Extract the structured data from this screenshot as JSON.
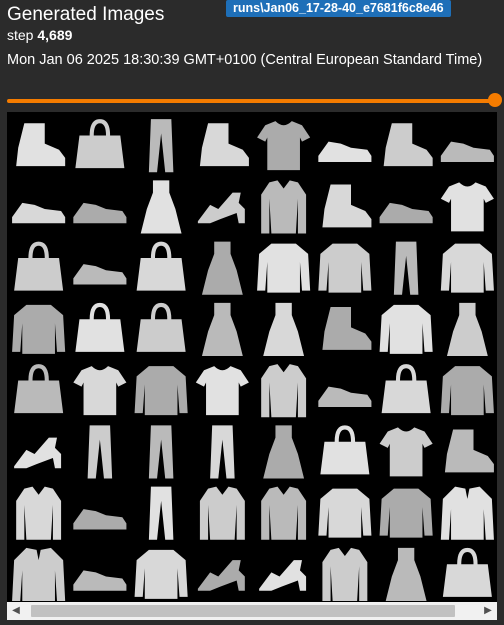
{
  "card": {
    "title": "Generated Images",
    "run_name": "runs\\Jan06_17-28-40_e7681f6c8e46",
    "step_label": "step",
    "step_value": "4,689",
    "timestamp": "Mon Jan 06 2025 18:30:39 GMT+0100 (Central European Standard Time)"
  },
  "slider": {
    "position_fraction": 1.0,
    "color": "#f57c00"
  },
  "image_grid": {
    "rows": 8,
    "cols": 8,
    "items": [
      [
        "ankle-boot",
        "bag",
        "trouser",
        "ankle-boot",
        "tshirt",
        "sneaker",
        "ankle-boot",
        "sneaker"
      ],
      [
        "sneaker",
        "sneaker",
        "dress",
        "sandal",
        "shirt",
        "ankle-boot",
        "sneaker",
        "tshirt"
      ],
      [
        "bag",
        "sneaker",
        "bag",
        "dress",
        "pullover",
        "pullover",
        "trouser",
        "pullover"
      ],
      [
        "pullover",
        "bag",
        "bag",
        "dress",
        "dress",
        "ankle-boot",
        "pullover",
        "dress"
      ],
      [
        "bag",
        "tshirt",
        "pullover",
        "tshirt",
        "shirt",
        "sneaker",
        "bag",
        "pullover"
      ],
      [
        "sandal",
        "trouser",
        "trouser",
        "trouser",
        "dress",
        "bag",
        "tshirt",
        "ankle-boot"
      ],
      [
        "shirt",
        "sneaker",
        "trouser",
        "shirt",
        "shirt",
        "pullover",
        "pullover",
        "coat"
      ],
      [
        "coat",
        "sneaker",
        "pullover",
        "sandal",
        "sandal",
        "shirt",
        "dress",
        "bag"
      ]
    ]
  },
  "icons": {
    "scroll_left": "◀",
    "scroll_right": "▶"
  },
  "colors": {
    "accent": "#f57c00",
    "run_badge": "#1e6fb8"
  }
}
